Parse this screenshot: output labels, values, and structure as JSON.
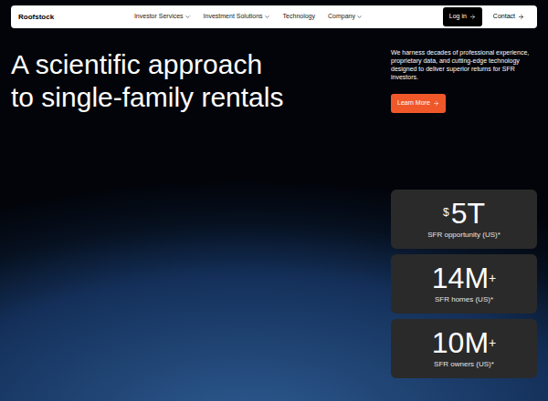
{
  "nav": {
    "logo": "Roofstock",
    "items": [
      {
        "label": "Investor Services",
        "dropdown": true
      },
      {
        "label": "Investment Solutions",
        "dropdown": true
      },
      {
        "label": "Technology",
        "dropdown": false
      },
      {
        "label": "Company",
        "dropdown": true
      }
    ],
    "login": "Log in",
    "contact": "Contact"
  },
  "hero": {
    "heading": [
      "A scientific approach",
      "to single-family rentals"
    ],
    "description": "We harness decades of professional experience, proprietary data, and cutting-edge technology designed to deliver superior returns for SFR investors.",
    "cta": "Learn More"
  },
  "stats": [
    {
      "prefix": "$",
      "value": "5T",
      "suffix": "",
      "label": "SFR opportunity (US)*"
    },
    {
      "prefix": "",
      "value": "14M",
      "suffix": "+",
      "label": "SFR homes (US)*"
    },
    {
      "prefix": "",
      "value": "10M",
      "suffix": "+",
      "label": "SFR owners (US)*"
    }
  ]
}
